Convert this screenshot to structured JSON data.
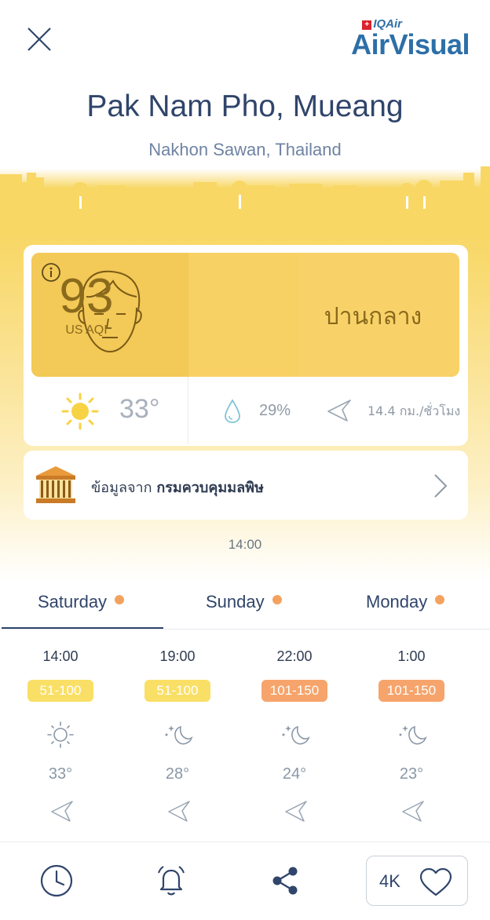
{
  "header": {
    "close_icon": "close-icon",
    "logo_small": "IQAir",
    "logo_brand": "AirVisual"
  },
  "location": {
    "city": "Pak Nam Pho, Mueang",
    "region": "Nakhon Sawan, Thailand"
  },
  "aqi": {
    "value": "93",
    "unit": "US AQI",
    "status": "ปานกลาง",
    "panel_color": "#f8d268"
  },
  "weather": {
    "temperature": "33°",
    "humidity": "29%",
    "wind": "14.4 กม./ชั่วโมง"
  },
  "source": {
    "prefix": "ข้อมูลจาก",
    "name": "กรมควบคุมมลพิษ"
  },
  "timestamp": "14:00",
  "tabs": [
    {
      "label": "Saturday",
      "dot_color": "#f3a25e"
    },
    {
      "label": "Sunday",
      "dot_color": "#f3a25e"
    },
    {
      "label": "Monday",
      "dot_color": "#f3a25e"
    }
  ],
  "forecast": [
    {
      "time": "14:00",
      "aqi_range": "51-100",
      "level_color": "#f9df66",
      "weather_icon": "sun-icon",
      "temp": "33°"
    },
    {
      "time": "19:00",
      "aqi_range": "51-100",
      "level_color": "#f9df66",
      "weather_icon": "moon-stars-icon",
      "temp": "28°"
    },
    {
      "time": "22:00",
      "aqi_range": "101-150",
      "level_color": "#f6a46c",
      "weather_icon": "moon-stars-icon",
      "temp": "24°"
    },
    {
      "time": "1:00",
      "aqi_range": "101-150",
      "level_color": "#f6a46c",
      "weather_icon": "moon-stars-icon",
      "temp": "23°"
    }
  ],
  "bottom_bar": {
    "history_icon": "clock-icon",
    "alert_icon": "bell-icon",
    "share_icon": "share-icon",
    "favorite_label": "4K"
  },
  "colors": {
    "accent": "#30456b",
    "moderate": "#f8d268",
    "unhealthy_sensitive": "#f6a46c",
    "brand": "#2d6fa8"
  }
}
